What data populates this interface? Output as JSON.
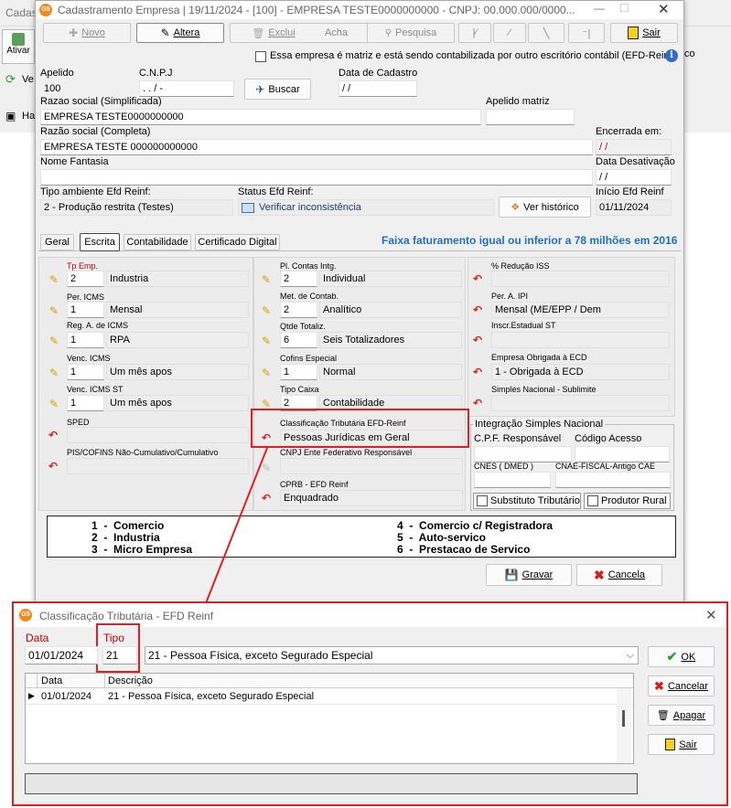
{
  "bg": {
    "title_fragment": "Cadas",
    "ativar": "Ativar",
    "ve": "Ve",
    "ha": "Ha",
    "co": "co"
  },
  "main_window": {
    "title": "Cadastramento Empresa | 19/11/2024 - [100] - EMPRESA TESTE0000000000 - CNPJ: 00.000.000/0000...",
    "toolbar": {
      "novo": "Novo",
      "altera": "Altera",
      "exclui": "Exclui",
      "acha": "Acha",
      "pesquisa": "Pesquisa",
      "sair": "Sair"
    },
    "matriz_checkbox_label": "Essa empresa é matriz e está sendo contabilizada por outro escritório contábil (EFD-Reinf",
    "apelido_label": "Apelido",
    "apelido_value": "100",
    "cnpj_label": "C.N.P.J",
    "cnpj_value": " .   .   /   -",
    "buscar": "Buscar",
    "data_cadastro_label": "Data de Cadastro",
    "data_cadastro_value": " /  /",
    "razao_simpl_label": "Razao social (Simplificada)",
    "razao_simpl_value": "EMPRESA TESTE0000000000",
    "apelido_matriz_label": "Apelido matriz",
    "razao_comp_label": "Razão social (Completa)",
    "razao_comp_value": "EMPRESA TESTE 000000000000",
    "encerrada_label": "Encerrada em:",
    "encerrada_value": " /  /",
    "fantasia_label": "Nome Fantasia",
    "data_desativacao_label": "Data Desativação",
    "data_desativacao_value": " /  /",
    "tipo_ambiente_label": "Tipo ambiente Efd Reinf:",
    "tipo_ambiente_value": "2 - Produção restrita (Testes)",
    "status_efd_label": "Status Efd Reinf:",
    "status_efd_value": "Verificar inconsistência",
    "ver_historico": "Ver histórico",
    "inicio_efd_label": "Início Efd Reinf",
    "inicio_efd_value": "01/11/2024",
    "tabs": [
      "Geral",
      "Escrita",
      "Contabilidade",
      "Certificado Digital"
    ],
    "faixa_text": "Faixa faturamento igual ou inferior a 78 milhões em 2016",
    "col1": {
      "tp_emp_label": "Tp Emp.",
      "tp_emp_code": "2",
      "tp_emp_desc": "Industria",
      "per_icms_label": "Per. ICMS",
      "per_icms_code": "1",
      "per_icms_desc": "Mensal",
      "reg_icms_label": "Reg. A. de ICMS",
      "reg_icms_code": "1",
      "reg_icms_desc": "RPA",
      "venc_icms_label": "Venc. ICMS",
      "venc_icms_code": "1",
      "venc_icms_desc": "Um mês apos",
      "venc_icms_st_label": "Venc. ICMS ST",
      "venc_icms_st_code": "1",
      "venc_icms_st_desc": "Um mês apos",
      "sped_label": "SPED",
      "pis_label": "PIS/COFINS Não-Cumulativo/Cumulativo"
    },
    "col2": {
      "pl_contas_label": "Pl. Contas Intg.",
      "pl_contas_code": "2",
      "pl_contas_desc": "Individual",
      "met_contab_label": "Met. de Contab.",
      "met_contab_code": "2",
      "met_contab_desc": "Analítico",
      "qtde_tot_label": "Qtde Totaliz.",
      "qtde_tot_code": "6",
      "qtde_tot_desc": "Seis Totalizadores",
      "cofins_label": "Cofins Especial",
      "cofins_code": "1",
      "cofins_desc": "Normal",
      "tipo_caixa_label": "Tipo Caixa",
      "tipo_caixa_code": "2",
      "tipo_caixa_desc": "Contabilidade",
      "class_trib_label": "Classificação Tributária EFD-Reinf",
      "class_trib_value": "Pessoas Jurídicas em Geral",
      "cnpj_ente_label": "CNPJ Ente Federativo Responsável",
      "cprb_label": "CPRB - EFD Reinf",
      "cprb_value": "Enquadrado"
    },
    "col3": {
      "reducao_iss_label": "% Redução ISS",
      "per_ipi_label": "Per. A.  IPI",
      "per_ipi_value": "Mensal (ME/EPP / Dem",
      "inscr_est_st_label": "Inscr.Estadual ST",
      "obrigada_ecd_label": "Empresa Obrigada à ECD",
      "obrigada_ecd_value": "1 - Obrigada à ECD",
      "simples_sublimite_label": "Simples Nacional - Sublimite",
      "integracao_title": "Integração Simples Nacional",
      "cpf_resp_label": "C.P.F. Responsável",
      "codigo_acesso_label": "Código Acesso",
      "cnes_label": "CNES ( DMED )",
      "cnae_fiscal_label": "CNAE-FISCAL-Antigo CAE",
      "substituto_label": "Substituto Tributário",
      "produtor_label": "Produtor Rural"
    },
    "legend": [
      {
        "num": "1",
        "text": "Comercio"
      },
      {
        "num": "2",
        "text": "Industria"
      },
      {
        "num": "3",
        "text": "Micro Empresa"
      },
      {
        "num": "4",
        "text": "Comercio c/ Registradora"
      },
      {
        "num": "5",
        "text": "Auto-servico"
      },
      {
        "num": "6",
        "text": "Prestacao de Servico"
      }
    ],
    "gravar": "Gravar",
    "cancela": "Cancela"
  },
  "dialog": {
    "title": "Classificação Tributária - EFD Reinf",
    "data_label": "Data",
    "tipo_label": "Tipo",
    "data_value": "01/01/2024",
    "tipo_value": "21",
    "combo_value": "21 - Pessoa Física, exceto Segurado Especial",
    "col_data": "Data",
    "col_descricao": "Descrição",
    "row": {
      "data": "01/01/2024",
      "descricao": "21 - Pessoa Física, exceto Segurado Especial"
    },
    "ok": "OK",
    "cancelar": "Cancelar",
    "apagar": "Apagar",
    "sair": "Sair"
  },
  "colors": {
    "highlight_red": "#e02020",
    "link_blue": "#1f6fc5",
    "label_red": "#c00000"
  }
}
